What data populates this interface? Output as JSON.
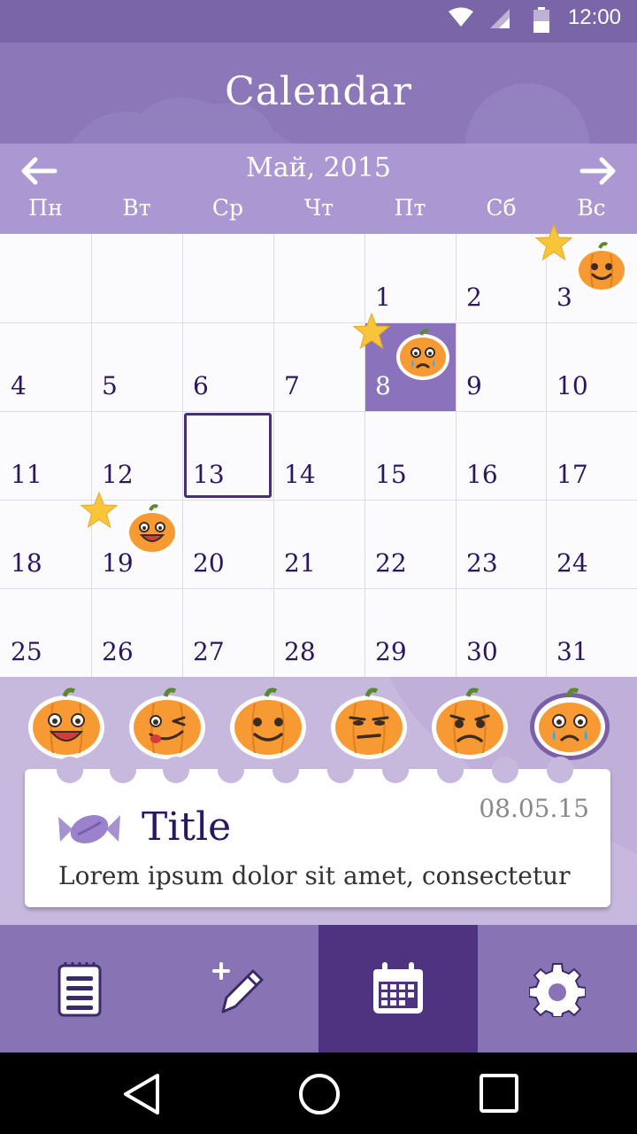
{
  "status_bar": {
    "time": "12:00"
  },
  "header": {
    "title": "Calendar"
  },
  "calendar": {
    "month_label": "Май, 2015",
    "weekdays": [
      "Пн",
      "Вт",
      "Ср",
      "Чт",
      "Пт",
      "Сб",
      "Вс"
    ],
    "weeks": [
      [
        "",
        "",
        "",
        "1",
        "2",
        "3",
        ""
      ],
      [
        "4",
        "5",
        "6",
        "7",
        "8",
        "9",
        "10"
      ],
      [
        "11",
        "12",
        "13",
        "14",
        "15",
        "16",
        "17"
      ],
      [
        "18",
        "19",
        "20",
        "21",
        "22",
        "23",
        "24"
      ],
      [
        "25",
        "26",
        "27",
        "28",
        "29",
        "30",
        "31"
      ]
    ],
    "selected_day": "8",
    "today": "13",
    "marked_days": [
      {
        "day": "3",
        "mood": "smile",
        "starred": true
      },
      {
        "day": "8",
        "mood": "cry",
        "starred": true
      },
      {
        "day": "19",
        "mood": "laugh",
        "starred": true
      }
    ]
  },
  "moods": [
    "laugh",
    "wink",
    "smile",
    "annoyed",
    "sad",
    "cry"
  ],
  "selected_mood": "cry",
  "note": {
    "date": "08.05.15",
    "title": "Title",
    "body": "Lorem ipsum dolor sit amet, consectetur"
  },
  "bottom_nav": {
    "tabs": [
      "notes-icon",
      "add-note-icon",
      "calendar-icon",
      "settings-icon"
    ],
    "active": "calendar-icon"
  },
  "colors": {
    "header": "#8c78b8",
    "month_bar": "#ab98d2",
    "selected_day": "#8a73bc",
    "active_tab": "#4e3480",
    "pumpkin": "#f89a33",
    "text_dark": "#2a1760"
  }
}
